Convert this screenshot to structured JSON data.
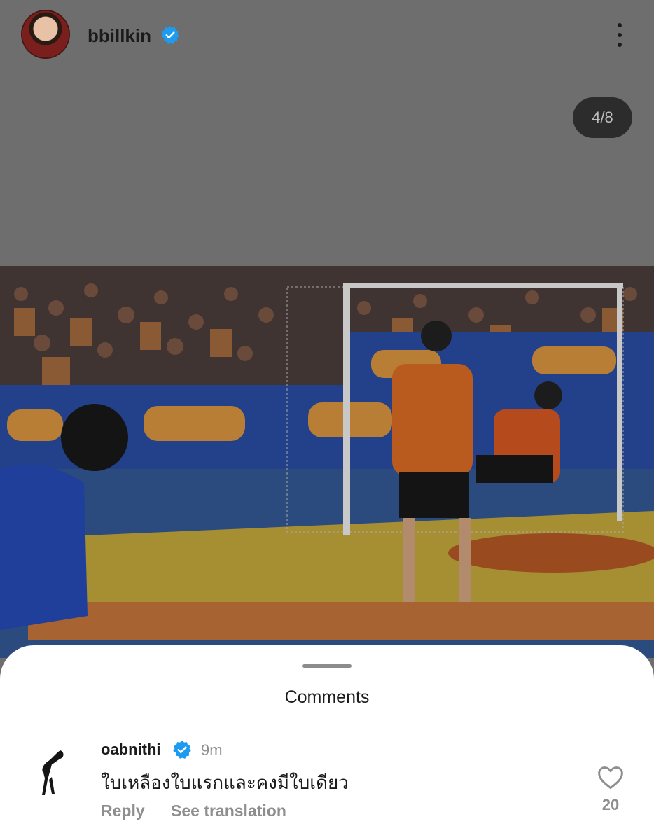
{
  "post": {
    "username": "bbillkin",
    "verified": true,
    "avatar_icon": "profile-photo",
    "more_icon": "more-vertical-icon",
    "carousel_position": "4/8"
  },
  "comments_sheet": {
    "title": "Comments",
    "comments": [
      {
        "username": "oabnithi",
        "verified": true,
        "time": "9m",
        "text": "ใบเหลืองใบแรกและคงมีใบเดียว",
        "reply_label": "Reply",
        "translate_label": "See translation",
        "like_count": "20",
        "like_icon": "heart-outline-icon"
      }
    ]
  },
  "colors": {
    "verified_badge": "#1d9bf0",
    "dim_overlay": "#6e6e6e",
    "sheet_background": "#ffffff",
    "muted_text": "#8e8e8e"
  }
}
